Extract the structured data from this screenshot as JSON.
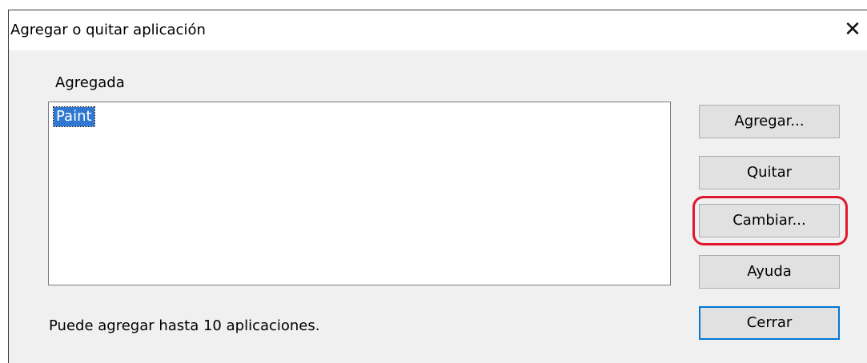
{
  "window": {
    "title": "Agregar o quitar aplicación",
    "close_glyph": "✕"
  },
  "group": {
    "label": "Agregada",
    "items": [
      "Paint"
    ],
    "selected_index": 0
  },
  "buttons": {
    "add": "Agregar...",
    "remove": "Quitar",
    "change": "Cambiar...",
    "help": "Ayuda",
    "close": "Cerrar"
  },
  "status_text": "Puede agregar hasta 10 aplicaciones.",
  "colors": {
    "selection": "#2f77d1",
    "highlight": "#e0182d",
    "default_button_border": "#0078d7"
  }
}
